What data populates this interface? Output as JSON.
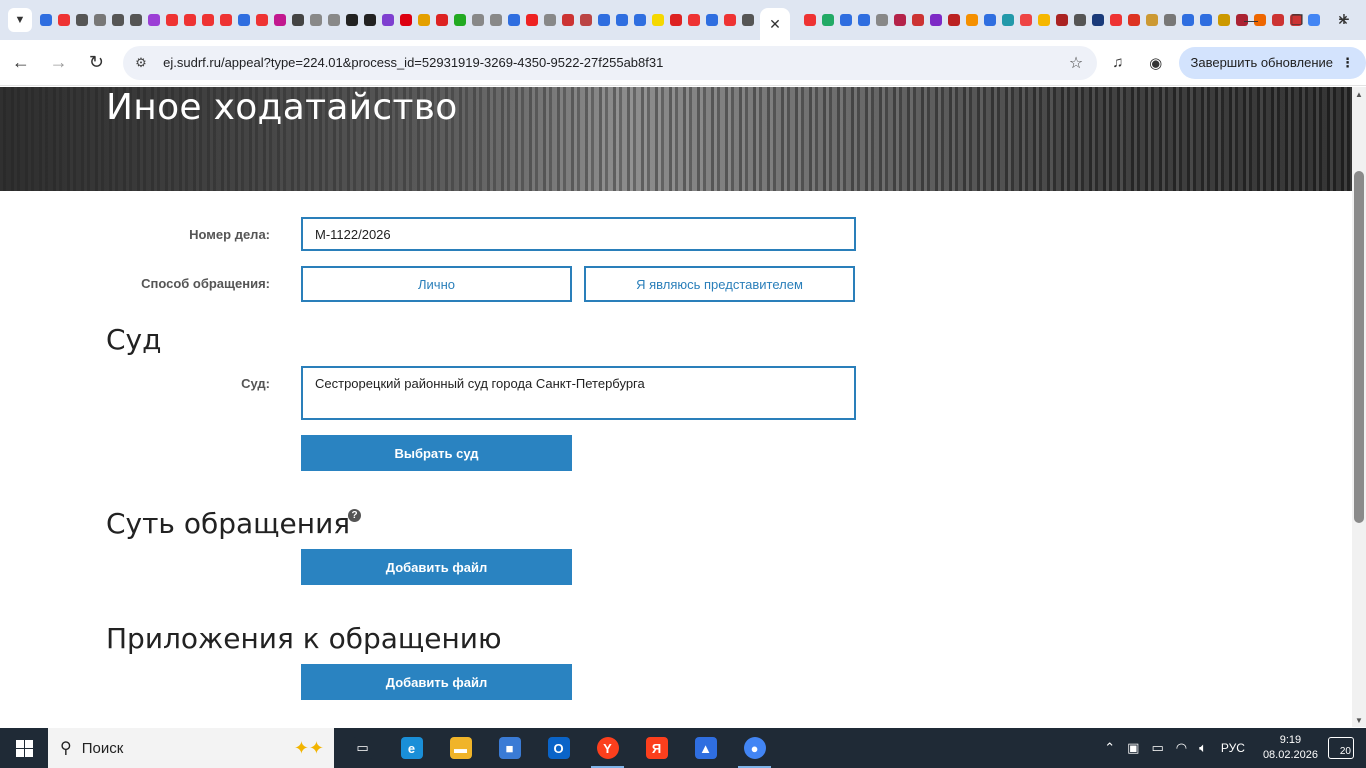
{
  "browser": {
    "tab_menu_icon": "chevron-down-icon",
    "active_tab_close": "✕",
    "new_tab": "+",
    "window_controls": [
      "—",
      "❐",
      "✕"
    ],
    "favicon_colors": [
      "#2f6ee0",
      "#e33",
      "#555",
      "#777",
      "#555",
      "#555",
      "#9b3fd6",
      "#e33",
      "#e33",
      "#e33",
      "#e33",
      "#2f6ee0",
      "#e33",
      "#c2188f",
      "#444",
      "#888",
      "#888",
      "#222",
      "#222",
      "#7e3fd0",
      "#d01",
      "#e4a000",
      "#d22",
      "#2a2",
      "#888",
      "#888",
      "#2f6ee0",
      "#e22",
      "#888",
      "#c33",
      "#b44",
      "#2f6ee0",
      "#2f6ee0",
      "#2f6ee0",
      "#f5d800",
      "#d22",
      "#e33",
      "#2f6ee0",
      "#e33",
      "#555"
    ],
    "favicon_colors_right": [
      "#e33",
      "#2a6",
      "#2f6ee0",
      "#2f6ee0",
      "#888",
      "#b4234a",
      "#c33",
      "#7d2ac6",
      "#b22",
      "#f59000",
      "#2f6ee0",
      "#29a",
      "#e44",
      "#f5b700",
      "#a22",
      "#555",
      "#1a3a7a",
      "#e33",
      "#d32",
      "#c93",
      "#777",
      "#2f6ee0",
      "#2f6ee0",
      "#c90",
      "#a23",
      "#e60",
      "#c33",
      "#c33",
      "#4285f4"
    ],
    "url": "ej.sudrf.ru/appeal?type=224.01&process_id=52931919-3269-4350-9522-27f255ab8f31",
    "update_button": "Завершить обновление"
  },
  "page": {
    "title": "Иное ходатайство",
    "case_number_label": "Номер дела:",
    "case_number_value": "М-1122/2026",
    "method_label": "Способ обращения:",
    "method_personal": "Лично",
    "method_representative": "Я являюсь представителем",
    "court_section_title": "Суд",
    "court_label": "Суд:",
    "court_value": "Сестрорецкий районный суд города Санкт-Петербурга",
    "choose_court_button": "Выбрать суд",
    "essence_section_title": "Суть обращения",
    "add_file_button_1": "Добавить файл",
    "attachments_section_title": "Приложения к обращению",
    "add_file_button_2": "Добавить файл"
  },
  "taskbar": {
    "search_text": "Поиск",
    "language": "РУС",
    "time": "9:19",
    "date": "08.02.2026",
    "notifications": "20",
    "apps": [
      {
        "name": "task-view",
        "color": "#1f2a36",
        "glyph": "▭"
      },
      {
        "name": "edge",
        "color": "#1a8fd8",
        "glyph": "e"
      },
      {
        "name": "file-explorer",
        "color": "#f0b429",
        "glyph": "▬"
      },
      {
        "name": "microsoft-store",
        "color": "#3a7bd5",
        "glyph": "■"
      },
      {
        "name": "outlook",
        "color": "#0a64c8",
        "glyph": "O"
      },
      {
        "name": "yandex-browser",
        "color": "#fc3f1d",
        "glyph": "Y"
      },
      {
        "name": "yandex",
        "color": "#fc3f1d",
        "glyph": "Я"
      },
      {
        "name": "yandex-disk",
        "color": "#2f6ee0",
        "glyph": "▲"
      },
      {
        "name": "chrome",
        "color": "#4285f4",
        "glyph": "●"
      }
    ]
  }
}
